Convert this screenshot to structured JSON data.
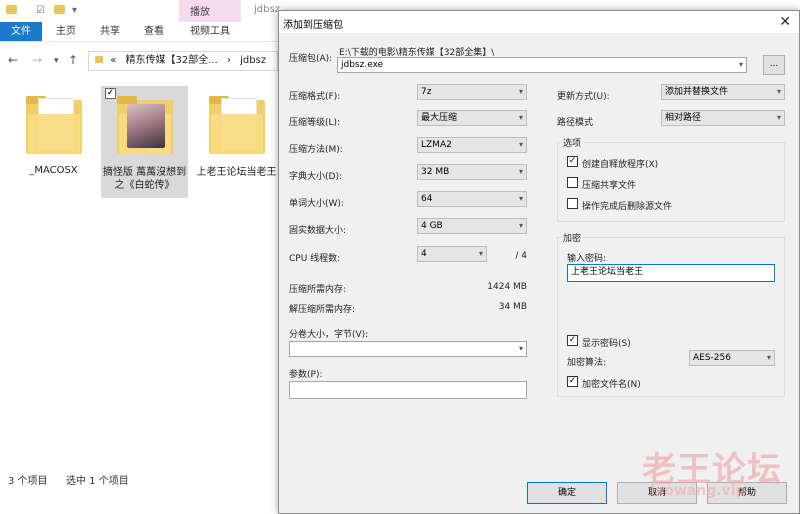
{
  "explorer": {
    "title": "jdbsz",
    "context_tab": "播放",
    "ribbon_tabs": [
      "文件",
      "主页",
      "共享",
      "查看",
      "视频工具"
    ],
    "breadcrumb": [
      "«",
      "精东传媒【32部全...",
      "›",
      "jdbsz"
    ],
    "items": [
      {
        "label": "_MACOSX"
      },
      {
        "label": "摘怪版 萬萬沒想到之《白蛇传》"
      },
      {
        "label": "上老王论坛当老王"
      }
    ],
    "status": {
      "count": "3 个项目",
      "selected": "选中 1 个项目"
    }
  },
  "dialog": {
    "title": "添加到压缩包",
    "archive_label": "压缩包(A):",
    "archive_path": "E:\\下载的电影\\精东传媒【32部全集】\\",
    "archive_name": "jdbsz.exe",
    "browse_label": "...",
    "left": {
      "format_label": "压缩格式(F):",
      "format_value": "7z",
      "level_label": "压缩等级(L):",
      "level_value": "最大压缩",
      "method_label": "压缩方法(M):",
      "method_value": "LZMA2",
      "dict_label": "字典大小(D):",
      "dict_value": "32 MB",
      "word_label": "单词大小(W):",
      "word_value": "64",
      "solid_label": "固实数据大小:",
      "solid_value": "4 GB",
      "threads_label": "CPU 线程数:",
      "threads_value": "4",
      "threads_total": "/ 4",
      "mem_comp_label": "压缩所需内存:",
      "mem_comp_value": "1424 MB",
      "mem_decomp_label": "解压缩所需内存:",
      "mem_decomp_value": "34 MB",
      "split_label": "分卷大小，字节(V):",
      "split_value": "",
      "params_label": "参数(P):",
      "params_value": ""
    },
    "right": {
      "update_label": "更新方式(U):",
      "update_value": "添加并替换文件",
      "path_label": "路径模式",
      "path_value": "相对路径",
      "options_title": "选项",
      "opt_sfx": "创建自释放程序(X)",
      "opt_shared": "压缩共享文件",
      "opt_delete": "操作完成后删除源文件",
      "encrypt_title": "加密",
      "password_label": "输入密码:",
      "password_value": "上老王论坛当老王",
      "show_password": "显示密码(S)",
      "enc_method_label": "加密算法:",
      "enc_method_value": "AES-256",
      "encrypt_names": "加密文件名(N)"
    },
    "buttons": {
      "ok": "确定",
      "cancel": "取消",
      "help": "帮助"
    }
  },
  "watermark": {
    "main": "老王论坛",
    "sub": "laowang.vip"
  }
}
